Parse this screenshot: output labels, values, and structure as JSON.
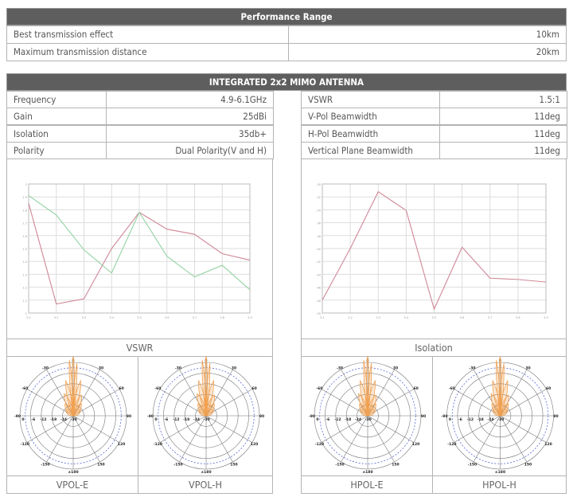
{
  "performance": {
    "title": "Performance Range",
    "rows": [
      {
        "label": "Best transmission effect",
        "value": "10km"
      },
      {
        "label": "Maximum transmission distance",
        "value": "20km"
      }
    ]
  },
  "antenna": {
    "title": "INTEGRATED 2x2 MIMO ANTENNA",
    "left": [
      {
        "label": "Frequency",
        "value": "4.9-6.1GHz"
      },
      {
        "label": "Gain",
        "value": "25dBi"
      },
      {
        "label": "Isolation",
        "value": "35db+"
      },
      {
        "label": "Polarity",
        "value": "Dual Polarity(V and H)"
      }
    ],
    "right": [
      {
        "label": "VSWR",
        "value": "1.5:1"
      },
      {
        "label": "V-Pol Beamwidth",
        "value": "11deg"
      },
      {
        "label": "H-Pol Beamwidth",
        "value": "11deg"
      },
      {
        "label": "Vertical Plane Beamwidth",
        "value": "11deg"
      }
    ]
  },
  "chart_data": [
    {
      "type": "line",
      "title": "VSWR",
      "x": [
        5.1,
        5.2,
        5.3,
        5.4,
        5.5,
        5.6,
        5.7,
        5.8,
        5.9
      ],
      "ylim": [
        1.0,
        2.0
      ],
      "yticks": [
        "1",
        "1.1",
        "1.2",
        "1.3",
        "1.4",
        "1.5",
        "1.6",
        "1.7",
        "1.8",
        "1.9",
        "2"
      ],
      "grid": true,
      "series": [
        {
          "color": "#cf8797",
          "values": [
            1.85,
            1.07,
            1.11,
            1.5,
            1.78,
            1.65,
            1.61,
            1.46,
            1.41
          ]
        },
        {
          "color": "#93d3a3",
          "values": [
            1.91,
            1.76,
            1.49,
            1.31,
            1.78,
            1.44,
            1.28,
            1.37,
            1.18
          ]
        }
      ]
    },
    {
      "type": "line",
      "title": "Isolation",
      "x": [
        5.1,
        5.2,
        5.3,
        5.4,
        5.5,
        5.6,
        5.7,
        5.8,
        5.9
      ],
      "ylim": [
        -50,
        -30
      ],
      "yticks": [
        "-50",
        "-48",
        "-46",
        "-44",
        "-42",
        "-40",
        "-38",
        "-36",
        "-34",
        "-32",
        "-30"
      ],
      "grid": true,
      "series": [
        {
          "color": "#cf8797",
          "values": [
            -48.0,
            -40.0,
            -31.2,
            -34.1,
            -49.4,
            -39.8,
            -44.6,
            -44.8,
            -45.2
          ]
        }
      ]
    }
  ],
  "polar": {
    "angles": [
      "0",
      "30",
      "60",
      "90",
      "120",
      "150",
      "±180",
      "-150",
      "-120",
      "-90",
      "-60",
      "-30"
    ],
    "radial": [
      "0",
      "-6",
      "-12",
      "-18",
      "-24",
      "-30"
    ],
    "lobe_color": "#f0a050",
    "plots": [
      {
        "title": "VPOL-E"
      },
      {
        "title": "VPOL-H"
      },
      {
        "title": "HPOL-E"
      },
      {
        "title": "HPOL-H"
      }
    ]
  }
}
